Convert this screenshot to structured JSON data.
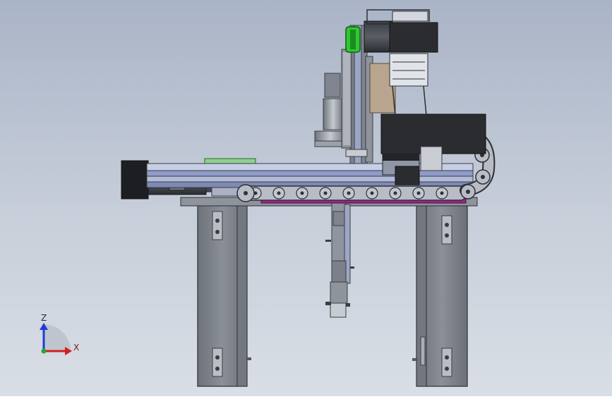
{
  "viewport": {
    "background_top": "#a9b4c7",
    "background_bottom": "#d9dee6"
  },
  "triad": {
    "z_label": "Z",
    "x_label": "X",
    "z_color": "#1f3bd6",
    "x_color": "#d41f1f",
    "origin_color": "#1fa83a"
  },
  "colors": {
    "steel": "#8e939c",
    "steel_dark": "#4a4e56",
    "motor_black": "#2a2c30",
    "rail_blue": "#8f9bc8",
    "magenta_strip": "#a1238a",
    "green_pulley": "#2fc833",
    "tan_plate": "#b9a58d",
    "chain_link": "#b7bcc5"
  }
}
